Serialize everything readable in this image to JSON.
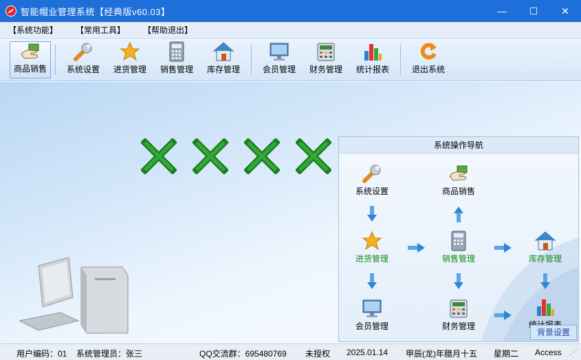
{
  "window": {
    "title": "智能帽业管理系统【经典版v60.03】",
    "minimize": "—",
    "maximize": "☐",
    "close": "✕"
  },
  "menu": [
    "【系统功能】",
    "【常用工具】",
    "【帮助退出】"
  ],
  "toolbar": [
    {
      "label": "商品销售",
      "icon": "hand-card-icon",
      "active": true
    },
    {
      "label": "系统设置",
      "icon": "wrench-icon"
    },
    {
      "label": "进货管理",
      "icon": "star-icon"
    },
    {
      "label": "销售管理",
      "icon": "calculator-icon"
    },
    {
      "label": "库存管理",
      "icon": "house-icon"
    },
    {
      "label": "会员管理",
      "icon": "monitor-icon"
    },
    {
      "label": "财务管理",
      "icon": "cash-register-icon"
    },
    {
      "label": "统计报表",
      "icon": "bar-chart-icon"
    },
    {
      "label": "退出系统",
      "icon": "exit-icon"
    }
  ],
  "nav": {
    "title": "系统操作导航",
    "nodes": {
      "settings": "系统设置",
      "sales": "商品销售",
      "purchase": "进货管理",
      "sales_mgmt": "销售管理",
      "inventory": "库存管理",
      "member": "会员管理",
      "finance": "财务管理",
      "report": "统计报表"
    },
    "bg_button": "背景设置"
  },
  "status": {
    "user_code": "用户编码：01",
    "admin": "系统管理员：张三",
    "qq": "QQ交流群：695480769",
    "license": "未授权",
    "date": "2025.01.14",
    "lunar": "甲辰(龙)年腊月十五",
    "weekday": "星期二",
    "db": "Access"
  },
  "colors": {
    "titlebar": "#1e6fd9",
    "cross": "#1a8a1f",
    "nav_green": "#178a1a"
  }
}
